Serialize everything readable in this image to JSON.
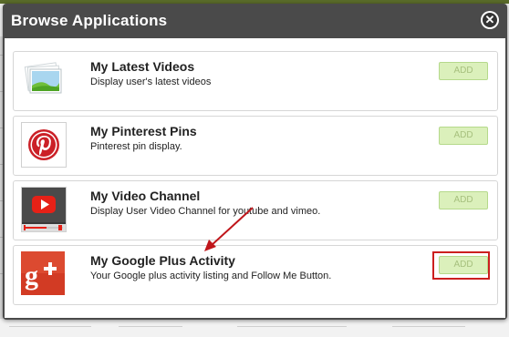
{
  "dialog": {
    "title": "Browse Applications",
    "close_icon": "close-circle-icon"
  },
  "apps": [
    {
      "name": "My Latest Videos",
      "description": "Display user's latest videos",
      "button_label": "ADD",
      "icon": "photo-stack-icon"
    },
    {
      "name": "My Pinterest Pins",
      "description": "Pinterest pin display.",
      "button_label": "ADD",
      "icon": "pinterest-logo-icon"
    },
    {
      "name": "My Video Channel",
      "description": "Display User Video Channel for youtube and vimeo.",
      "button_label": "ADD",
      "icon": "youtube-play-icon"
    },
    {
      "name": "My Google Plus Activity",
      "description": "Your Google plus activity listing and Follow Me Button.",
      "button_label": "ADD",
      "icon": "google-plus-icon"
    }
  ],
  "annotation": {
    "highlighted_app": "My Google Plus Activity",
    "arrow_color": "#c0161b",
    "box_color": "#cc1f1f"
  },
  "colors": {
    "titlebar": "#4a4a4a",
    "add_button_bg": "#dbf0bb",
    "add_button_text": "#a7c07e"
  }
}
